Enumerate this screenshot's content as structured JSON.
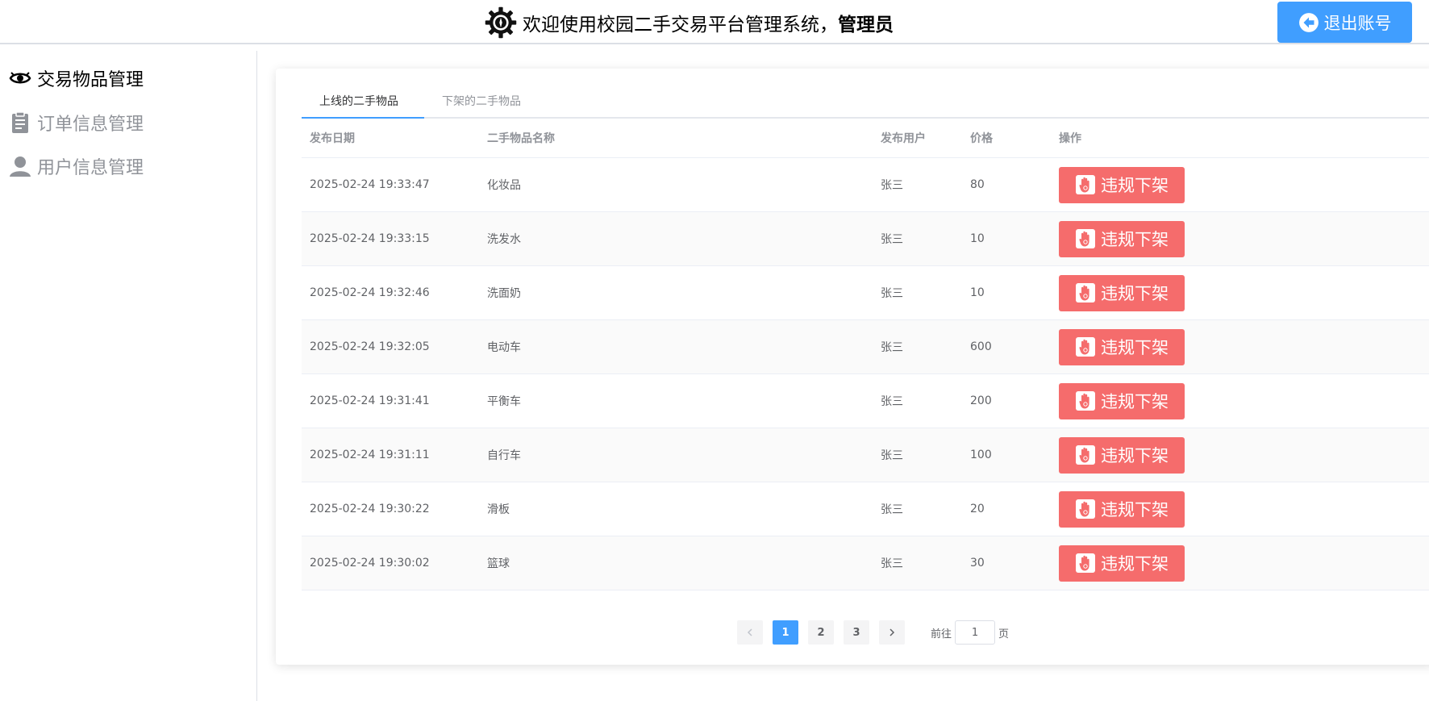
{
  "header": {
    "welcome": "欢迎使用校园二手交易平台管理系统，",
    "role": "管理员",
    "logout_label": "退出账号"
  },
  "sidebar": {
    "items": [
      {
        "label": "交易物品管理",
        "icon": "goods-eye-icon",
        "active": true
      },
      {
        "label": "订单信息管理",
        "icon": "clipboard-icon",
        "active": false
      },
      {
        "label": "用户信息管理",
        "icon": "user-icon",
        "active": false
      }
    ]
  },
  "tabs": [
    {
      "label": "上线的二手物品",
      "active": true
    },
    {
      "label": "下架的二手物品",
      "active": false
    }
  ],
  "table": {
    "columns": [
      "发布日期",
      "二手物品名称",
      "发布用户",
      "价格",
      "操作"
    ],
    "action_label": "违规下架",
    "rows": [
      {
        "date": "2025-02-24 19:33:47",
        "name": "化妆品",
        "user": "张三",
        "price": "80"
      },
      {
        "date": "2025-02-24 19:33:15",
        "name": "洗发水",
        "user": "张三",
        "price": "10"
      },
      {
        "date": "2025-02-24 19:32:46",
        "name": "洗面奶",
        "user": "张三",
        "price": "10"
      },
      {
        "date": "2025-02-24 19:32:05",
        "name": "电动车",
        "user": "张三",
        "price": "600"
      },
      {
        "date": "2025-02-24 19:31:41",
        "name": "平衡车",
        "user": "张三",
        "price": "200"
      },
      {
        "date": "2025-02-24 19:31:11",
        "name": "自行车",
        "user": "张三",
        "price": "100"
      },
      {
        "date": "2025-02-24 19:30:22",
        "name": "滑板",
        "user": "张三",
        "price": "20"
      },
      {
        "date": "2025-02-24 19:30:02",
        "name": "篮球",
        "user": "张三",
        "price": "30"
      }
    ]
  },
  "pagination": {
    "pages": [
      "1",
      "2",
      "3"
    ],
    "current": "1",
    "goto_label": "前往",
    "goto_value": "1",
    "goto_suffix": "页"
  },
  "colors": {
    "primary": "#409eff",
    "danger": "#f56c6c"
  }
}
